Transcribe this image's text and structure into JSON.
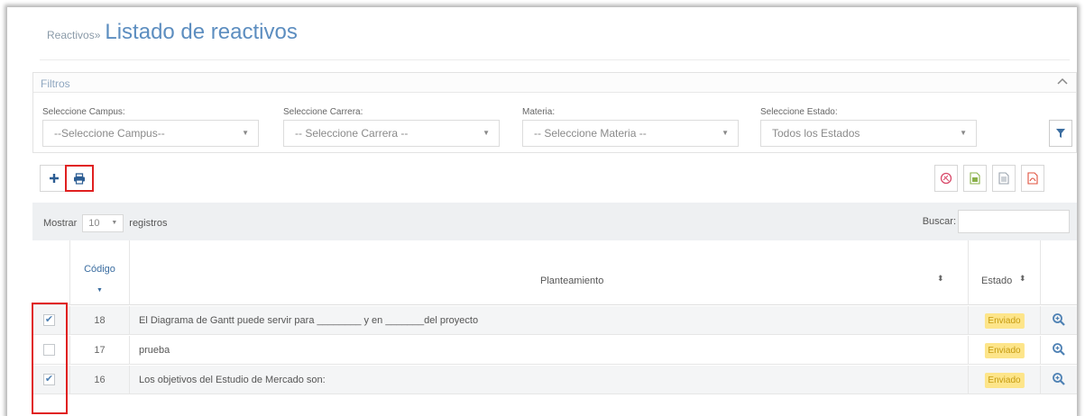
{
  "header": {
    "breadcrumb": "Reactivos",
    "separator": "»",
    "title": "Listado de reactivos"
  },
  "filters": {
    "title": "Filtros",
    "campus": {
      "label": "Seleccione Campus:",
      "value": "--Seleccione Campus--"
    },
    "carrera": {
      "label": "Seleccione Carrera:",
      "value": "-- Seleccione Carrera --"
    },
    "materia": {
      "label": "Materia:",
      "value": "-- Seleccione Materia --"
    },
    "estado": {
      "label": "Seleccione Estado:",
      "value": "Todos los Estados"
    },
    "filter_button_icon": "filter-icon"
  },
  "toolbar": {
    "add_icon": "plus-icon",
    "print_icon": "print-icon",
    "right_icons": [
      "copy-icon",
      "excel-icon",
      "csv-icon",
      "pdf-icon"
    ]
  },
  "table": {
    "length_prefix": "Mostrar",
    "length_value": "10",
    "length_suffix": "registros",
    "search_label": "Buscar:",
    "columns": [
      "Código",
      "Planteamiento",
      "Estado"
    ],
    "rows": [
      {
        "checked": true,
        "code": "18",
        "text": "El Diagrama de Gantt puede servir para ________ y en _______del proyecto",
        "status": "Enviado"
      },
      {
        "checked": false,
        "code": "17",
        "text": "prueba",
        "status": "Enviado"
      },
      {
        "checked": true,
        "code": "16",
        "text": "Los objetivos del Estudio de Mercado son:",
        "status": "Enviado"
      }
    ]
  },
  "colors": {
    "accent": "#5d8ec0",
    "badge_bg": "#fde58a",
    "highlight": "#e02020"
  }
}
